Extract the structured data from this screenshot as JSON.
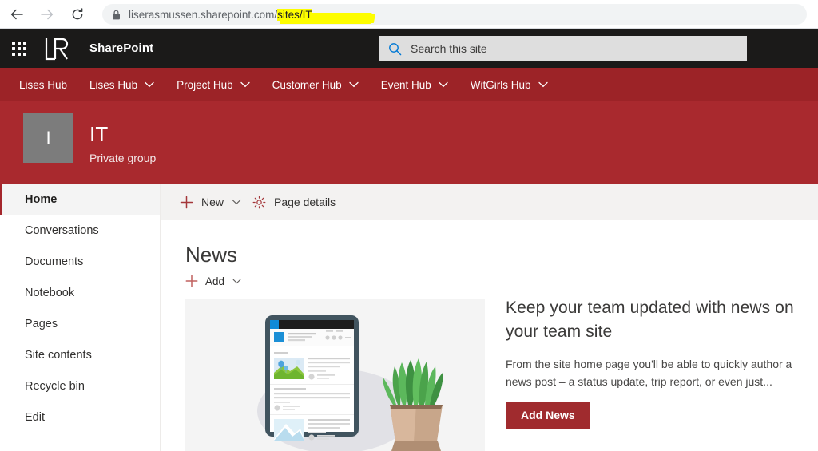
{
  "browser": {
    "back_icon": "back-arrow-icon",
    "forward_icon": "forward-arrow-icon",
    "reload_icon": "reload-icon",
    "lock_icon": "lock-icon",
    "url_prefix": "liserasmussen.sharepoint.com/",
    "url_highlighted": "sites/IT",
    "highlight_color": "#fdfd00"
  },
  "suite": {
    "waffle_icon": "app-launcher-icon",
    "logo_text": "LR",
    "title": "SharePoint",
    "bar_color": "#1b1a19"
  },
  "search": {
    "icon": "search-icon",
    "placeholder": "Search this site",
    "value": ""
  },
  "hub_nav": {
    "bar_color": "#9c2327",
    "items": [
      {
        "label": "Lises Hub",
        "has_chevron": false
      },
      {
        "label": "Lises Hub",
        "has_chevron": true
      },
      {
        "label": "Project Hub",
        "has_chevron": true
      },
      {
        "label": "Customer Hub",
        "has_chevron": true
      },
      {
        "label": "Event Hub",
        "has_chevron": true
      },
      {
        "label": "WitGirls Hub",
        "has_chevron": true
      }
    ]
  },
  "site_header": {
    "bar_color": "#a9292e",
    "logo_letter": "I",
    "logo_color": "#7c7c7c",
    "title": "IT",
    "privacy": "Private group"
  },
  "left_nav": {
    "items": [
      {
        "label": "Home",
        "selected": true
      },
      {
        "label": "Conversations",
        "selected": false
      },
      {
        "label": "Documents",
        "selected": false
      },
      {
        "label": "Notebook",
        "selected": false
      },
      {
        "label": "Pages",
        "selected": false
      },
      {
        "label": "Site contents",
        "selected": false
      },
      {
        "label": "Recycle bin",
        "selected": false
      },
      {
        "label": "Edit",
        "selected": false
      }
    ],
    "accent_color": "#a4262c"
  },
  "command_bar": {
    "new_label": "New",
    "new_icon": "plus-icon",
    "new_chevron_icon": "chevron-down-icon",
    "page_details_label": "Page details",
    "page_details_icon": "gear-icon",
    "background": "#f3f2f1"
  },
  "news": {
    "section_title": "News",
    "add_label": "Add",
    "add_icon": "plus-icon",
    "add_chevron_icon": "chevron-down-icon",
    "card_image": "tablet-and-plant-illustration",
    "headline": "Keep your team updated with news on your team site",
    "description": "From the site home page you'll be able to quickly author a news post – a status update, trip report, or even just...",
    "button_label": "Add News",
    "button_color": "#a02b2e"
  }
}
